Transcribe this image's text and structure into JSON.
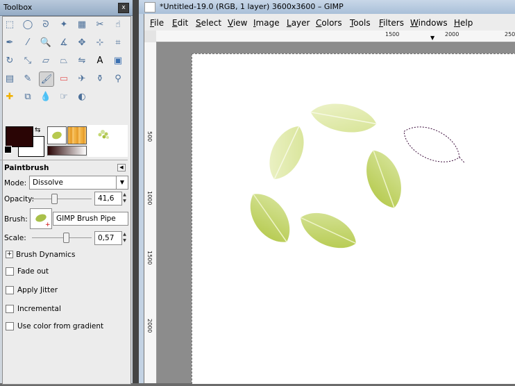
{
  "toolbox": {
    "title": "Toolbox",
    "close_symbol": "x",
    "tool_icons": [
      "rect-select-icon",
      "ellipse-select-icon",
      "free-select-icon",
      "fuzzy-select-icon",
      "select-by-color-icon",
      "scissors-select-icon",
      "foreground-select-icon",
      "paths-icon",
      "color-picker-icon",
      "zoom-icon",
      "measure-icon",
      "move-icon",
      "align-icon",
      "crop-icon",
      "rotate-icon",
      "scale-icon",
      "shear-icon",
      "perspective-icon",
      "flip-icon",
      "text-icon",
      "bucket-fill-icon",
      "blend-icon",
      "pencil-icon",
      "paintbrush-icon",
      "eraser-icon",
      "airbrush-icon",
      "ink-icon",
      "clone-icon",
      "heal-icon",
      "perspective-clone-icon",
      "blur-icon",
      "smudge-icon",
      "dodge-burn-icon"
    ],
    "active_tool": "paintbrush-icon",
    "fg_color": "#2a0505",
    "bg_color": "#ffffff",
    "options": {
      "title": "Paintbrush",
      "mode_label": "Mode:",
      "mode_value": "Dissolve",
      "opacity_label": "Opacity:",
      "opacity_value": "41,6",
      "opacity_level": 0.416,
      "brush_label": "Brush:",
      "brush_value": "GIMP Brush Pipe",
      "scale_label": "Scale:",
      "scale_value": "0,57",
      "scale_level": 0.57,
      "brush_dynamics": "Brush Dynamics",
      "fade_out": "Fade out",
      "apply_jitter": "Apply Jitter",
      "incremental": "Incremental",
      "use_color_from_gradient": "Use color from gradient"
    }
  },
  "image_window": {
    "title": "*Untitled-19.0 (RGB, 1 layer) 3600x3600 – GIMP",
    "menu": [
      "File",
      "Edit",
      "Select",
      "View",
      "Image",
      "Layer",
      "Colors",
      "Tools",
      "Filters",
      "Windows",
      "Help"
    ],
    "ruler_h": [
      "1500",
      "2000",
      "250"
    ],
    "ruler_v": [
      "500",
      "1000",
      "1500",
      "2000"
    ],
    "leaf_colors": {
      "pale": "#dfe8a8",
      "mid": "#c9d860",
      "vein": "#f5f8dc"
    }
  }
}
